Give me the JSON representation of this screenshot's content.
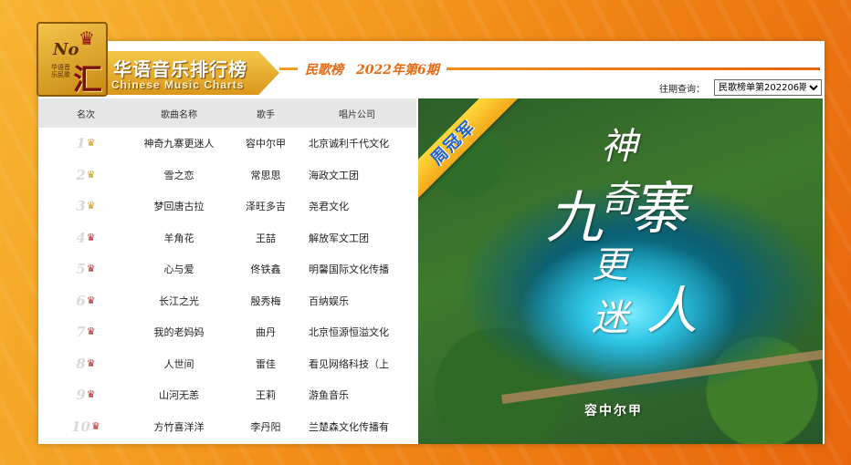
{
  "logo": {
    "no_text": "No",
    "small_text": "华语音乐民歌",
    "hui_char": "汇",
    "title": "华语音乐排行榜",
    "subtitle": "Chinese Music Charts"
  },
  "header": {
    "issue_title": "民歌榜　2022年第6期",
    "history_label": "往期查询：",
    "history_selected": "民歌榜单第202206期"
  },
  "table": {
    "headers": {
      "rank": "名次",
      "title": "歌曲名称",
      "artist": "歌手",
      "label": "唱片公司"
    },
    "rows": [
      {
        "rank": "1",
        "title": "神奇九寨更迷人",
        "artist": "容中尔甲",
        "label": "北京诚利千代文化"
      },
      {
        "rank": "2",
        "title": "雪之恋",
        "artist": "常思思",
        "label": "海政文工团"
      },
      {
        "rank": "3",
        "title": "梦回唐古拉",
        "artist": "泽旺多吉",
        "label": "尧君文化"
      },
      {
        "rank": "4",
        "title": "羊角花",
        "artist": "王喆",
        "label": "解放军文工团"
      },
      {
        "rank": "5",
        "title": "心与爱",
        "artist": "佟铁鑫",
        "label": "明馨国际文化传播"
      },
      {
        "rank": "6",
        "title": "长江之光",
        "artist": "殷秀梅",
        "label": "百纳娱乐"
      },
      {
        "rank": "7",
        "title": "我的老妈妈",
        "artist": "曲丹",
        "label": "北京恒源恒溢文化"
      },
      {
        "rank": "8",
        "title": "人世间",
        "artist": "雷佳",
        "label": "看见网络科技（上"
      },
      {
        "rank": "9",
        "title": "山河无恙",
        "artist": "王莉",
        "label": "游鱼音乐"
      },
      {
        "rank": "10",
        "title": "方竹喜洋洋",
        "artist": "李丹阳",
        "label": "兰楚森文化传播有"
      }
    ]
  },
  "cover": {
    "ribbon": "周冠军",
    "calligraphy": [
      "神奇",
      "九",
      "寨",
      "更迷",
      "人"
    ],
    "artist": "容中尔甲"
  },
  "icons": {
    "top3": "crown-gold-icon",
    "others": "crown-red-icon"
  },
  "colors": {
    "accent": "#e56a12",
    "gold": "#d69a12",
    "crown_red": "#b22a2a",
    "ribbon_text": "#1e5fd0"
  }
}
